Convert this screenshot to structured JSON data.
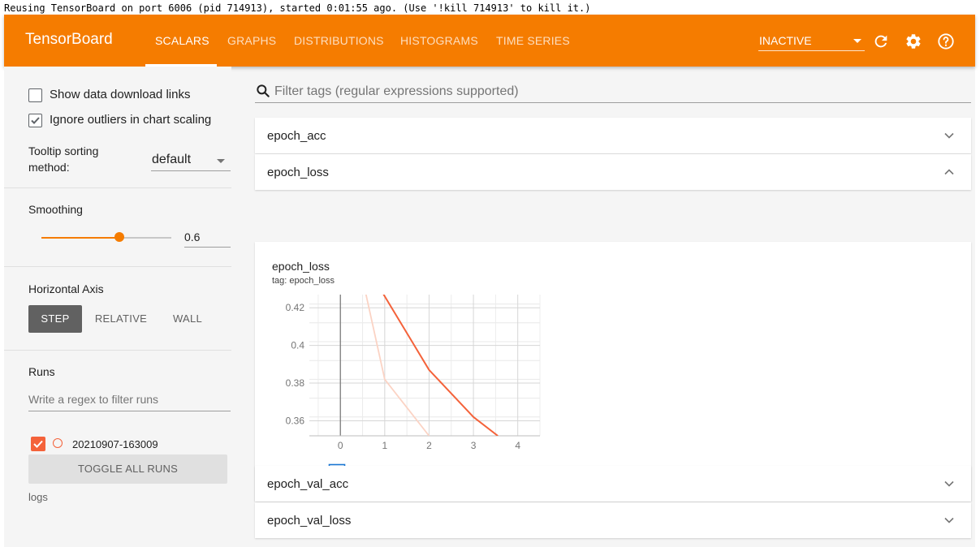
{
  "console": {
    "message": "Reusing TensorBoard on port 6006 (pid 714913), started 0:01:55 ago. (Use '!kill 714913' to kill it.)"
  },
  "topbar": {
    "brand": "TensorBoard",
    "tabs": [
      {
        "label": "SCALARS",
        "active": true
      },
      {
        "label": "GRAPHS",
        "active": false
      },
      {
        "label": "DISTRIBUTIONS",
        "active": false
      },
      {
        "label": "HISTOGRAMS",
        "active": false
      },
      {
        "label": "TIME SERIES",
        "active": false
      }
    ],
    "status_select": "INACTIVE",
    "icons": [
      "refresh-icon",
      "settings-icon",
      "help-icon"
    ],
    "color": "#f57c00"
  },
  "sidebar": {
    "show_download_links": {
      "label": "Show data download links",
      "checked": false
    },
    "ignore_outliers": {
      "label": "Ignore outliers in chart scaling",
      "checked": true
    },
    "tooltip_sorting": {
      "label_line1": "Tooltip sorting",
      "label_line2": "method:",
      "value": "default"
    },
    "smoothing": {
      "label": "Smoothing",
      "value": "0.6",
      "fraction": 0.6
    },
    "horizontal_axis": {
      "label": "Horizontal Axis",
      "options": [
        {
          "label": "STEP",
          "active": true
        },
        {
          "label": "RELATIVE",
          "active": false
        },
        {
          "label": "WALL",
          "active": false
        }
      ]
    },
    "runs": {
      "label": "Runs",
      "filter_placeholder": "Write a regex to filter runs",
      "items": [
        {
          "name": "20210907-163009",
          "checked": true,
          "color": "#f4623a"
        }
      ],
      "toggle_label": "TOGGLE ALL RUNS",
      "logdir": "logs"
    }
  },
  "main": {
    "filter_placeholder": "Filter tags (regular expressions supported)",
    "categories": [
      {
        "name": "epoch_acc",
        "expanded": false
      },
      {
        "name": "epoch_loss",
        "expanded": true
      },
      {
        "name": "epoch_val_acc",
        "expanded": false
      },
      {
        "name": "epoch_val_loss",
        "expanded": false
      }
    ],
    "card": {
      "title": "epoch_loss",
      "tag": "tag: epoch_loss"
    }
  },
  "chart_data": {
    "type": "line",
    "title": "epoch_loss",
    "xlabel": "",
    "ylabel": "",
    "xlim": [
      -0.7,
      4.5
    ],
    "ylim": [
      0.352,
      0.427
    ],
    "x_ticks": [
      "0",
      "1",
      "2",
      "3",
      "4"
    ],
    "y_ticks": [
      "0.36",
      "0.38",
      "0.4",
      "0.42"
    ],
    "series": [
      {
        "name": "20210907-163009",
        "style": "smoothed",
        "color": "#f4623a",
        "x": [
          0.9,
          2,
          3,
          3.55
        ],
        "y": [
          0.43,
          0.387,
          0.362,
          0.352
        ]
      },
      {
        "name": "20210907-163009",
        "style": "raw",
        "color": "#fbd3c4",
        "x": [
          0.55,
          1,
          2
        ],
        "y": [
          0.43,
          0.382,
          0.352
        ]
      }
    ],
    "grid": true
  }
}
